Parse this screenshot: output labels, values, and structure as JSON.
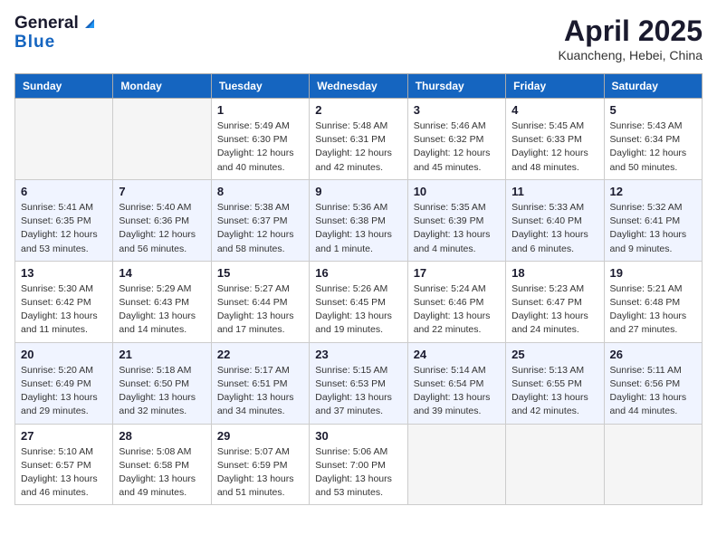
{
  "header": {
    "logo_general": "General",
    "logo_blue": "Blue",
    "month": "April 2025",
    "location": "Kuancheng, Hebei, China"
  },
  "weekdays": [
    "Sunday",
    "Monday",
    "Tuesday",
    "Wednesday",
    "Thursday",
    "Friday",
    "Saturday"
  ],
  "weeks": [
    [
      {
        "day": "",
        "info": ""
      },
      {
        "day": "",
        "info": ""
      },
      {
        "day": "1",
        "info": "Sunrise: 5:49 AM\nSunset: 6:30 PM\nDaylight: 12 hours and 40 minutes."
      },
      {
        "day": "2",
        "info": "Sunrise: 5:48 AM\nSunset: 6:31 PM\nDaylight: 12 hours and 42 minutes."
      },
      {
        "day": "3",
        "info": "Sunrise: 5:46 AM\nSunset: 6:32 PM\nDaylight: 12 hours and 45 minutes."
      },
      {
        "day": "4",
        "info": "Sunrise: 5:45 AM\nSunset: 6:33 PM\nDaylight: 12 hours and 48 minutes."
      },
      {
        "day": "5",
        "info": "Sunrise: 5:43 AM\nSunset: 6:34 PM\nDaylight: 12 hours and 50 minutes."
      }
    ],
    [
      {
        "day": "6",
        "info": "Sunrise: 5:41 AM\nSunset: 6:35 PM\nDaylight: 12 hours and 53 minutes."
      },
      {
        "day": "7",
        "info": "Sunrise: 5:40 AM\nSunset: 6:36 PM\nDaylight: 12 hours and 56 minutes."
      },
      {
        "day": "8",
        "info": "Sunrise: 5:38 AM\nSunset: 6:37 PM\nDaylight: 12 hours and 58 minutes."
      },
      {
        "day": "9",
        "info": "Sunrise: 5:36 AM\nSunset: 6:38 PM\nDaylight: 13 hours and 1 minute."
      },
      {
        "day": "10",
        "info": "Sunrise: 5:35 AM\nSunset: 6:39 PM\nDaylight: 13 hours and 4 minutes."
      },
      {
        "day": "11",
        "info": "Sunrise: 5:33 AM\nSunset: 6:40 PM\nDaylight: 13 hours and 6 minutes."
      },
      {
        "day": "12",
        "info": "Sunrise: 5:32 AM\nSunset: 6:41 PM\nDaylight: 13 hours and 9 minutes."
      }
    ],
    [
      {
        "day": "13",
        "info": "Sunrise: 5:30 AM\nSunset: 6:42 PM\nDaylight: 13 hours and 11 minutes."
      },
      {
        "day": "14",
        "info": "Sunrise: 5:29 AM\nSunset: 6:43 PM\nDaylight: 13 hours and 14 minutes."
      },
      {
        "day": "15",
        "info": "Sunrise: 5:27 AM\nSunset: 6:44 PM\nDaylight: 13 hours and 17 minutes."
      },
      {
        "day": "16",
        "info": "Sunrise: 5:26 AM\nSunset: 6:45 PM\nDaylight: 13 hours and 19 minutes."
      },
      {
        "day": "17",
        "info": "Sunrise: 5:24 AM\nSunset: 6:46 PM\nDaylight: 13 hours and 22 minutes."
      },
      {
        "day": "18",
        "info": "Sunrise: 5:23 AM\nSunset: 6:47 PM\nDaylight: 13 hours and 24 minutes."
      },
      {
        "day": "19",
        "info": "Sunrise: 5:21 AM\nSunset: 6:48 PM\nDaylight: 13 hours and 27 minutes."
      }
    ],
    [
      {
        "day": "20",
        "info": "Sunrise: 5:20 AM\nSunset: 6:49 PM\nDaylight: 13 hours and 29 minutes."
      },
      {
        "day": "21",
        "info": "Sunrise: 5:18 AM\nSunset: 6:50 PM\nDaylight: 13 hours and 32 minutes."
      },
      {
        "day": "22",
        "info": "Sunrise: 5:17 AM\nSunset: 6:51 PM\nDaylight: 13 hours and 34 minutes."
      },
      {
        "day": "23",
        "info": "Sunrise: 5:15 AM\nSunset: 6:53 PM\nDaylight: 13 hours and 37 minutes."
      },
      {
        "day": "24",
        "info": "Sunrise: 5:14 AM\nSunset: 6:54 PM\nDaylight: 13 hours and 39 minutes."
      },
      {
        "day": "25",
        "info": "Sunrise: 5:13 AM\nSunset: 6:55 PM\nDaylight: 13 hours and 42 minutes."
      },
      {
        "day": "26",
        "info": "Sunrise: 5:11 AM\nSunset: 6:56 PM\nDaylight: 13 hours and 44 minutes."
      }
    ],
    [
      {
        "day": "27",
        "info": "Sunrise: 5:10 AM\nSunset: 6:57 PM\nDaylight: 13 hours and 46 minutes."
      },
      {
        "day": "28",
        "info": "Sunrise: 5:08 AM\nSunset: 6:58 PM\nDaylight: 13 hours and 49 minutes."
      },
      {
        "day": "29",
        "info": "Sunrise: 5:07 AM\nSunset: 6:59 PM\nDaylight: 13 hours and 51 minutes."
      },
      {
        "day": "30",
        "info": "Sunrise: 5:06 AM\nSunset: 7:00 PM\nDaylight: 13 hours and 53 minutes."
      },
      {
        "day": "",
        "info": ""
      },
      {
        "day": "",
        "info": ""
      },
      {
        "day": "",
        "info": ""
      }
    ]
  ]
}
